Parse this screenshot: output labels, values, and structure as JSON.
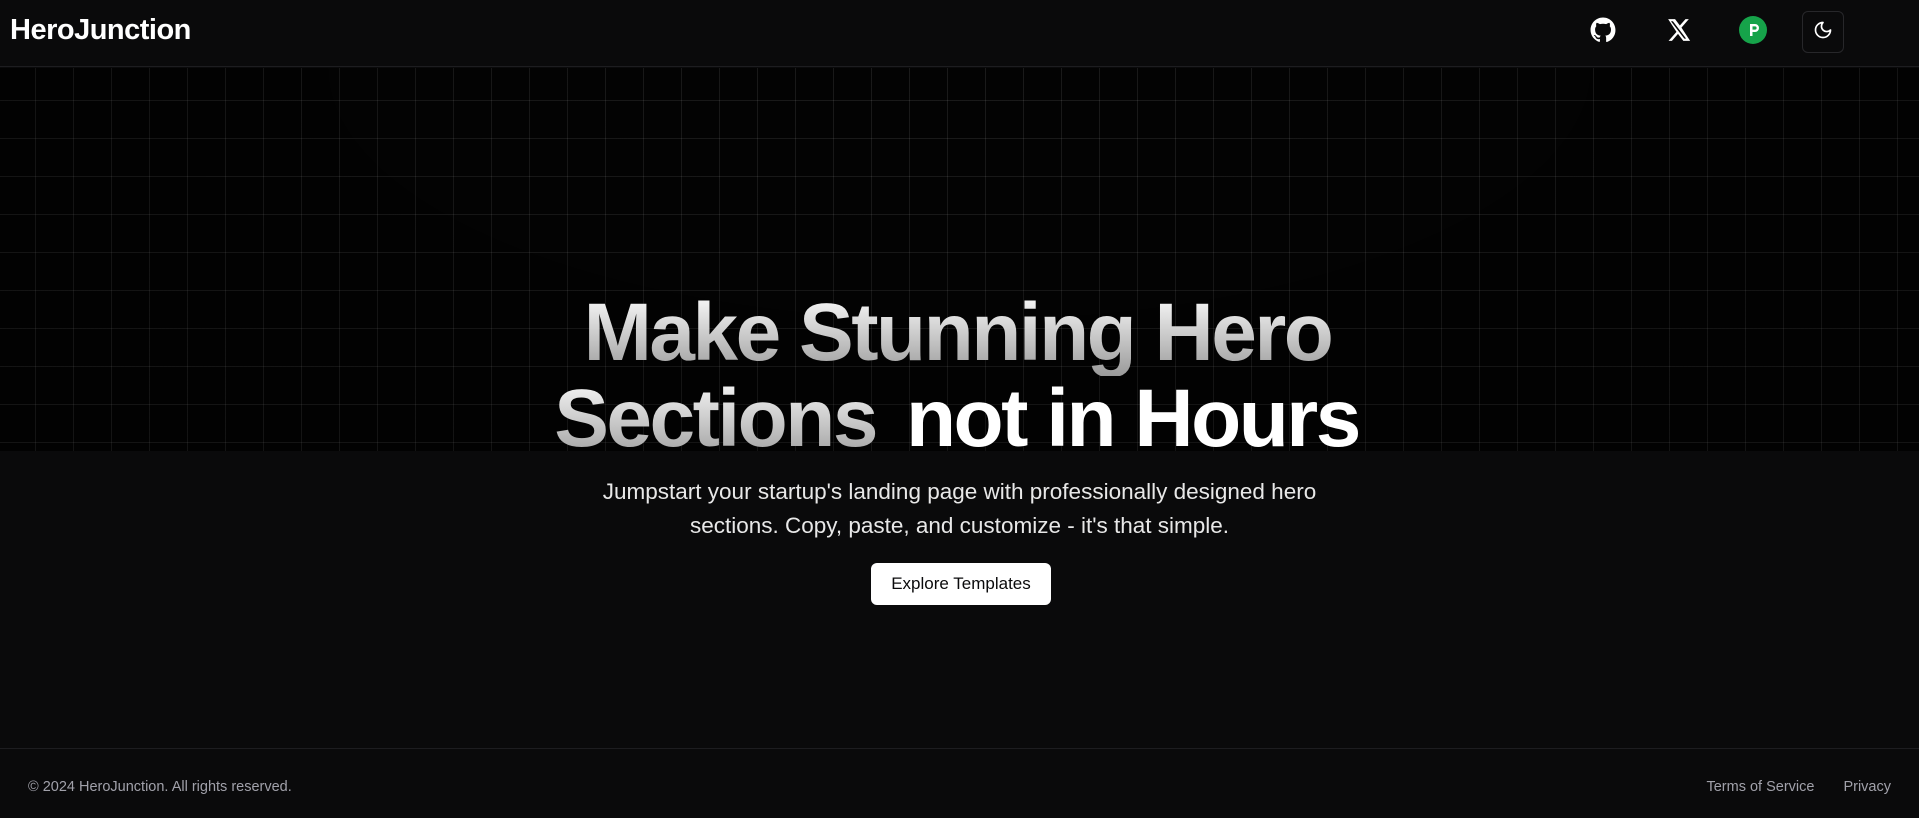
{
  "header": {
    "brand": "HeroJunction",
    "icons": [
      {
        "name": "github-icon"
      },
      {
        "name": "x-twitter-icon"
      },
      {
        "name": "producthunt-icon",
        "color": "#16a34a",
        "letter": "P"
      },
      {
        "name": "moon-icon"
      }
    ]
  },
  "hero": {
    "headline_line1": "Make Stunning Hero",
    "headline_line2a": "Sections",
    "headline_line2b": "not in Hours",
    "subtitle": "Jumpstart your startup's landing page with professionally designed hero sections. Copy, paste, and customize - it's that simple.",
    "cta_label": "Explore Templates"
  },
  "footer": {
    "copyright": "© 2024 HeroJunction. All rights reserved.",
    "links": [
      "Terms of Service",
      "Privacy"
    ]
  },
  "colors": {
    "background": "#0a0a0b",
    "grid_background": "#030303",
    "producthunt_green": "#16a34a",
    "cta_background": "#ffffff"
  }
}
